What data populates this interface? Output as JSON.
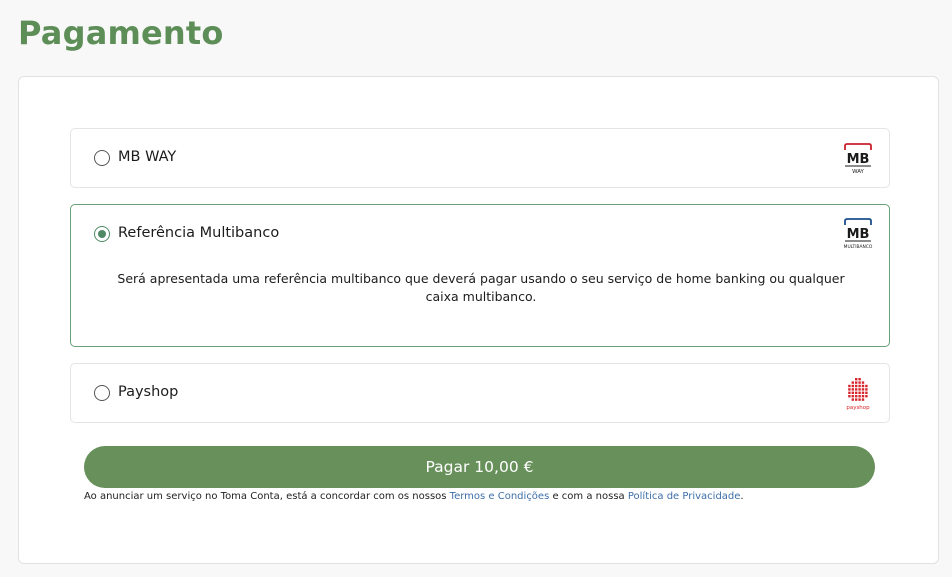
{
  "page": {
    "title": "Pagamento"
  },
  "colors": {
    "brand_green": "#5e8e57",
    "button_green": "#67905a",
    "selected_border": "#6aa07a",
    "link_blue": "#3e6fa8",
    "mb_red": "#c8202b",
    "mb_blue": "#1c4f8c",
    "payshop_red": "#d6242a"
  },
  "payment_options": [
    {
      "id": "mbway",
      "label": "MB WAY",
      "selected": false,
      "logo": {
        "name": "mbway-logo",
        "text_main": "MB",
        "text_sub": "WAY"
      }
    },
    {
      "id": "multibanco",
      "label": "Referência Multibanco",
      "selected": true,
      "description": "Será apresentada uma referência multibanco que deverá pagar usando o seu serviço de home banking ou qualquer caixa multibanco.",
      "logo": {
        "name": "multibanco-logo",
        "text_main": "MB",
        "text_sub": "MULTIBANCO"
      }
    },
    {
      "id": "payshop",
      "label": "Payshop",
      "selected": false,
      "logo": {
        "name": "payshop-logo",
        "text_sub": "payshop"
      }
    }
  ],
  "pay_button": {
    "label": "Pagar 10,00 €"
  },
  "terms": {
    "prefix": "Ao anunciar um serviço no Toma Conta, está a concordar com os nossos ",
    "terms_link": "Termos e Condições",
    "middle": " e com a nossa ",
    "privacy_link": "Política de Privacidade",
    "suffix": "."
  }
}
